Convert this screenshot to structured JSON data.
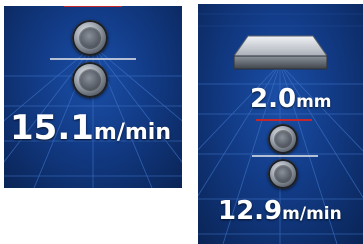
{
  "left_panel": {
    "speed_value": "15.1",
    "speed_unit": "m/min"
  },
  "right_panel": {
    "thickness_value": "2.0",
    "thickness_unit": "mm",
    "speed_value": "12.9",
    "speed_unit": "m/min"
  },
  "colors": {
    "panel_background": "#123b86",
    "grid_lines": "#3f74c8",
    "text": "#ffffff",
    "red_marker": "#c3262c"
  },
  "icons": {
    "roller": "roller-icon",
    "die": "die-block-icon"
  }
}
